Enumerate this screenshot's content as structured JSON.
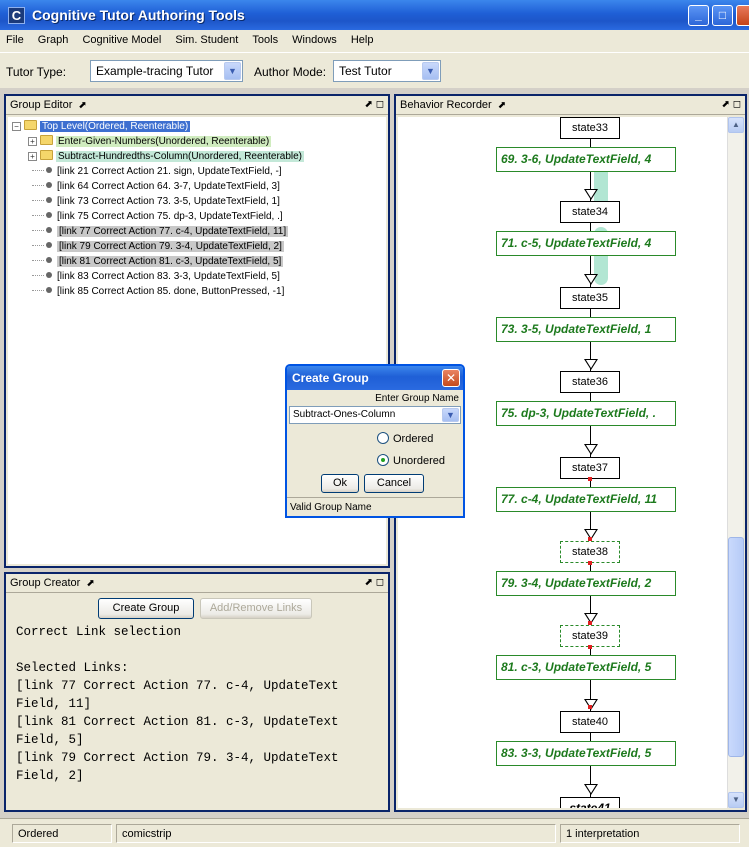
{
  "window": {
    "title": "Cognitive Tutor Authoring Tools",
    "icon_letter": "C"
  },
  "menu": [
    "File",
    "Graph",
    "Cognitive Model",
    "Sim. Student",
    "Tools",
    "Windows",
    "Help"
  ],
  "toolbar": {
    "tutor_type_label": "Tutor Type:",
    "tutor_type_value": "Example-tracing Tutor",
    "author_mode_label": "Author Mode:",
    "author_mode_value": "Test Tutor"
  },
  "group_editor": {
    "title": "Group Editor",
    "root": "Top Level(Ordered, Reenterable)",
    "groups": [
      "Enter-Given-Numbers(Unordered, Reenterable)",
      "Subtract-Hundredths-Column(Unordered, Reenterable)"
    ],
    "links": [
      "[link 21 Correct Action 21. sign, UpdateTextField, -]",
      "[link 64 Correct Action 64. 3-7, UpdateTextField, 3]",
      "[link 73 Correct Action 73. 3-5, UpdateTextField, 1]",
      "[link 75 Correct Action 75. dp-3, UpdateTextField, .]",
      "[link 77 Correct Action 77. c-4, UpdateTextField, 11]",
      "[link 79 Correct Action 79. 3-4, UpdateTextField, 2]",
      "[link 81 Correct Action 81. c-3, UpdateTextField, 5]",
      "[link 83 Correct Action 83. 3-3, UpdateTextField, 5]",
      "[link 85 Correct Action 85. done, ButtonPressed, -1]"
    ]
  },
  "group_creator": {
    "title": "Group Creator",
    "create_button": "Create Group",
    "add_remove_button": "Add/Remove Links",
    "lines": [
      "Correct Link selection",
      "",
      "Selected Links:",
      "[link 77 Correct Action 77. c-4, UpdateText",
      "Field, 11]",
      "[link 81 Correct Action 81. c-3, UpdateText",
      "Field, 5]",
      "[link 79 Correct Action 79. 3-4, UpdateText",
      "Field, 2]"
    ]
  },
  "behavior_recorder": {
    "title": "Behavior Recorder",
    "states": [
      "state33",
      "state34",
      "state35",
      "state36",
      "state37",
      "state38",
      "state39",
      "state40",
      "state41"
    ],
    "edges": [
      "69. 3-6, UpdateTextField, 4",
      "71. c-5, UpdateTextField, 4",
      "73. 3-5, UpdateTextField, 1",
      "75. dp-3, UpdateTextField, .",
      "77. c-4, UpdateTextField, 11",
      "79. 3-4, UpdateTextField, 2",
      "81. c-3, UpdateTextField, 5",
      "83. 3-3, UpdateTextField, 5"
    ]
  },
  "dialog": {
    "title": "Create Group",
    "prompt": "Enter Group Name",
    "name_value": "Subtract-Ones-Column",
    "option_ordered": "Ordered",
    "option_unordered": "Unordered",
    "ok": "Ok",
    "cancel": "Cancel",
    "status": "Valid Group Name"
  },
  "status_bar": {
    "mode": "Ordered",
    "problem": "comicstrip",
    "interpretations": "1 interpretation"
  },
  "colors": {
    "titlebar": "#1f5fd6",
    "edge_green": "#1d7a1d",
    "selection_blue": "#3d6fd0"
  }
}
